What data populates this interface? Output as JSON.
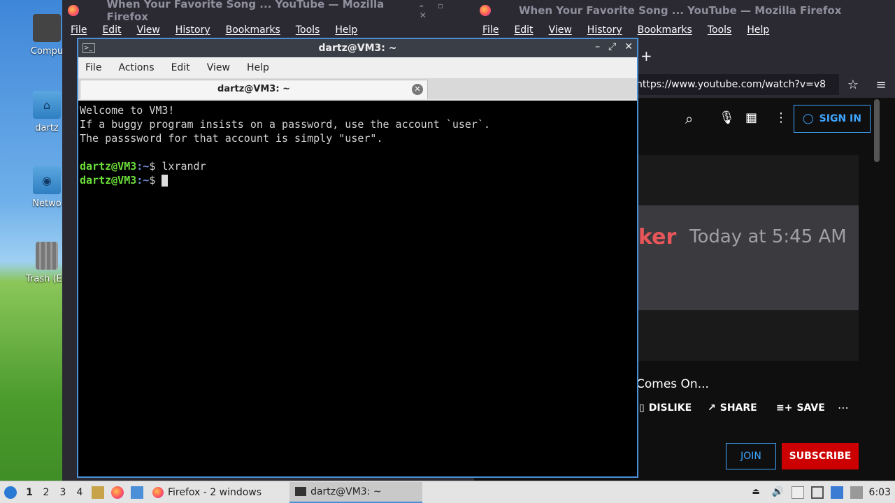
{
  "desktop": {
    "icons": [
      {
        "label": "Compu",
        "icon": "computer-icon"
      },
      {
        "label": "dartz",
        "icon": "home-folder-icon"
      },
      {
        "label": "Netwo",
        "icon": "network-icon"
      },
      {
        "label": "Trash (En",
        "icon": "trash-icon"
      }
    ]
  },
  "firefox_left": {
    "title": "When Your Favorite Song ... YouTube — Mozilla Firefox",
    "menu": [
      "File",
      "Edit",
      "View",
      "History",
      "Bookmarks",
      "Tools",
      "Help"
    ]
  },
  "firefox_right": {
    "title": "When Your Favorite Song ... YouTube — Mozilla Firefox",
    "menu": [
      "File",
      "Edit",
      "View",
      "History",
      "Bookmarks",
      "Tools",
      "Help"
    ],
    "url": "https://www.youtube.com/watch?v=v8",
    "sign_in": "SIGN IN",
    "video_text_partial": "ker",
    "video_timestamp": "Today at 5:45 AM",
    "video_title_partial": "Comes On...",
    "actions": {
      "dislike": "DISLIKE",
      "share": "SHARE",
      "save": "SAVE"
    },
    "join": "JOIN",
    "subscribe": "SUBSCRIBE",
    "colors": {
      "subscribe": "#cc0000",
      "join_border": "#3ea6ff",
      "bg": "#0f0f0f"
    }
  },
  "terminal": {
    "title": "dartz@VM3: ~",
    "menu": [
      "File",
      "Actions",
      "Edit",
      "View",
      "Help"
    ],
    "tab_title": "dartz@VM3: ~",
    "lines": [
      "Welcome to VM3!",
      "If a buggy program insists on a password, use the account `user`.",
      "The passsword for that account is simply \"user\"."
    ],
    "prompt_user": "dartz@VM3",
    "prompt_path": ":~",
    "prompt_symbol": "$",
    "command1": " lxrandr",
    "command2": " "
  },
  "taskbar": {
    "workspaces": [
      "1",
      "2",
      "3",
      "4"
    ],
    "tasks": [
      {
        "label": "Firefox - 2 windows",
        "icon": "firefox-icon"
      },
      {
        "label": "dartz@VM3: ~",
        "icon": "terminal-icon"
      }
    ],
    "clock": "6:03"
  }
}
